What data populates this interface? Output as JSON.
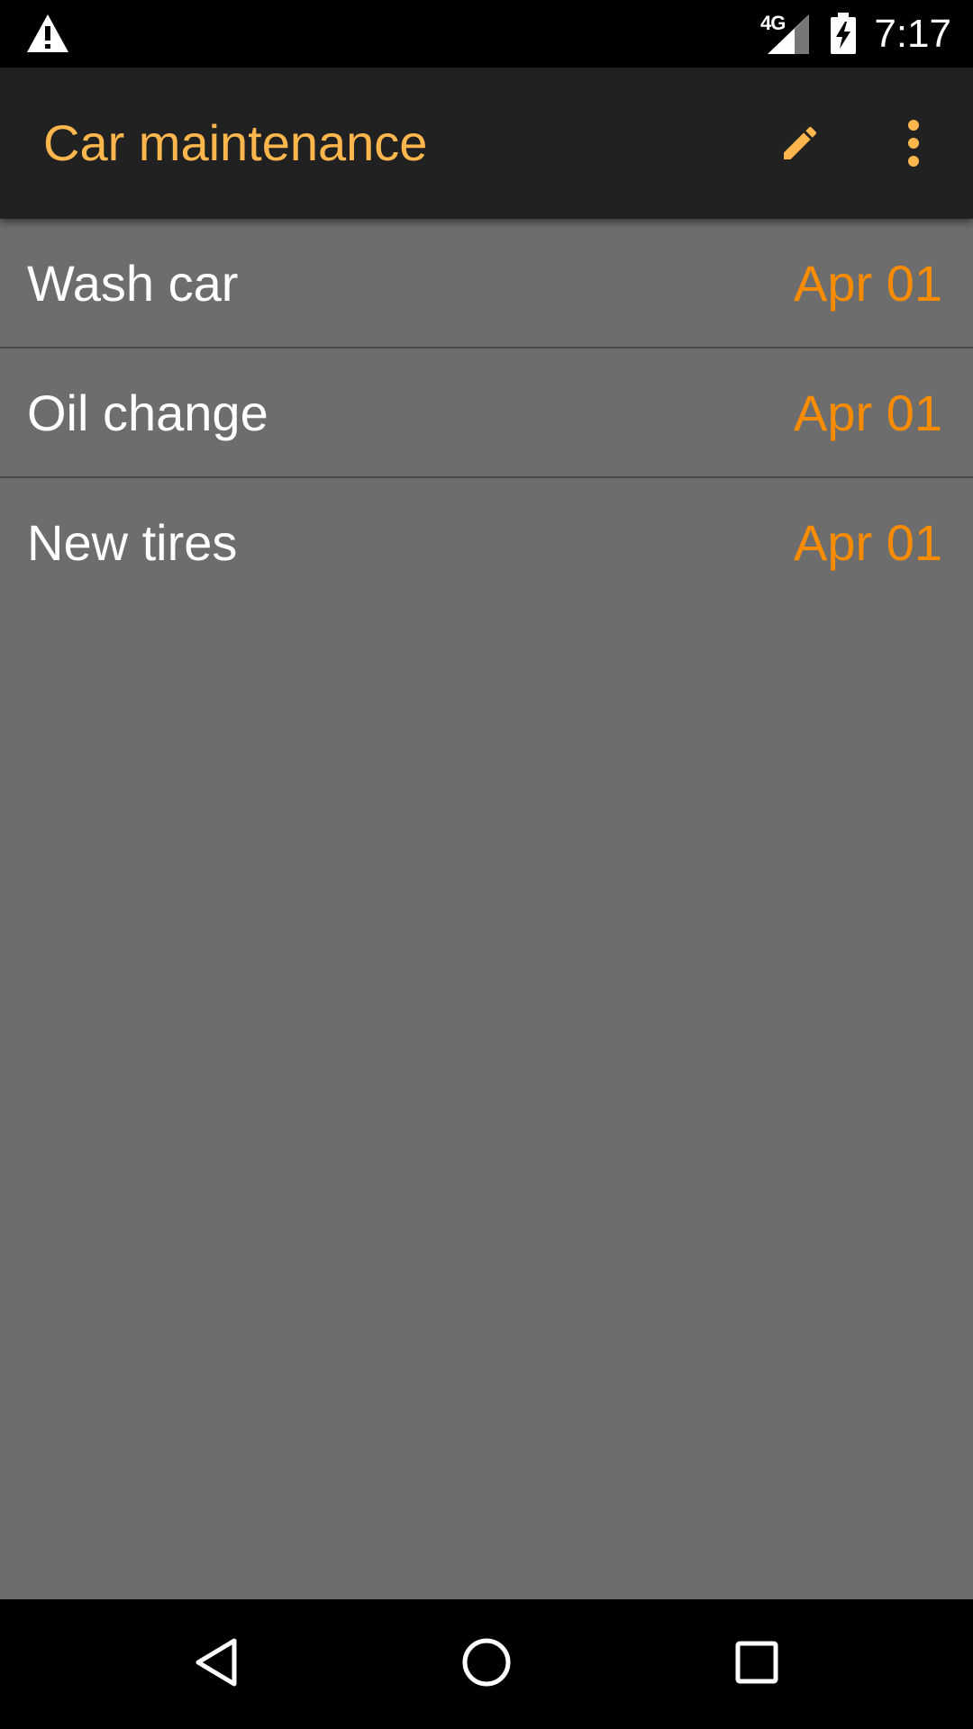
{
  "status_bar": {
    "network_label": "4G",
    "time": "7:17",
    "icons": [
      "warning-icon",
      "signal-icon",
      "battery-charging-icon"
    ]
  },
  "app_bar": {
    "title": "Car maintenance",
    "actions": [
      "edit-icon",
      "more-vert-icon"
    ]
  },
  "list": {
    "items": [
      {
        "title": "Wash car",
        "date": "Apr 01"
      },
      {
        "title": "Oil change",
        "date": "Apr 01"
      },
      {
        "title": "New tires",
        "date": "Apr 01"
      }
    ]
  },
  "nav_bar": {
    "buttons": [
      "back-icon",
      "home-icon",
      "recents-icon"
    ]
  },
  "colors": {
    "accent": "#ffb74d",
    "date": "#fb8c00",
    "app_bar_bg": "#212121",
    "list_bg": "#6d6d6d"
  }
}
